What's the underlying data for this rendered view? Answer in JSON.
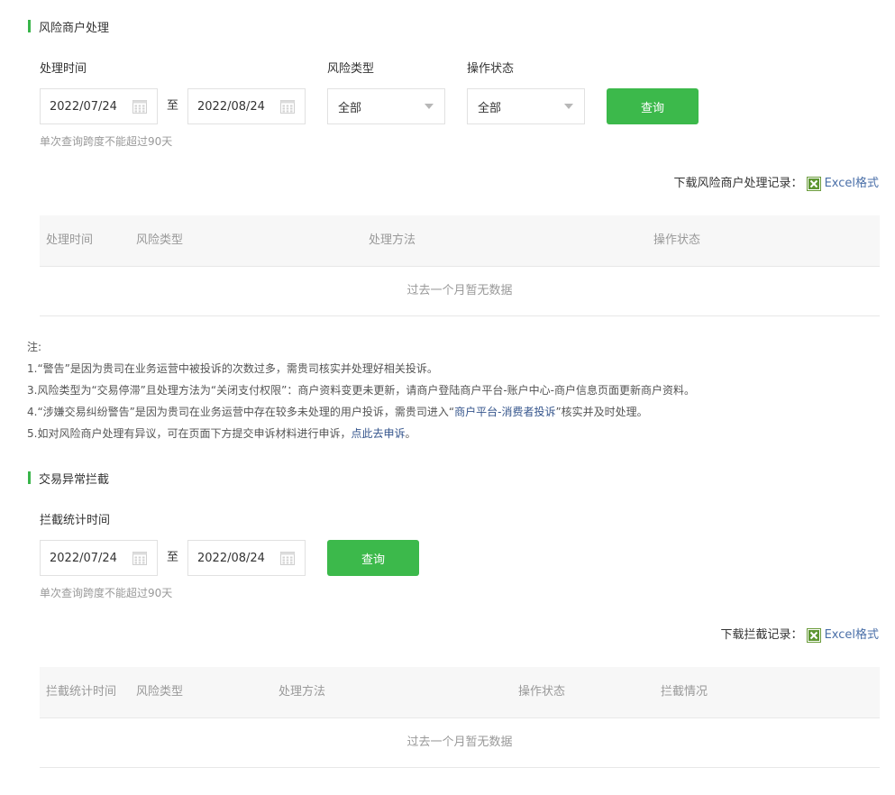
{
  "risk_section": {
    "title": "风险商户处理",
    "labels": {
      "time": "处理时间",
      "risk_type": "风险类型",
      "status": "操作状态"
    },
    "start_date": "2022/07/24",
    "to": "至",
    "end_date": "2022/08/24",
    "risk_type_value": "全部",
    "status_value": "全部",
    "query_button": "查询",
    "hint": "单次查询跨度不能超过90天",
    "download_label": "下载风险商户处理记录：",
    "download_link": "Excel格式",
    "table": {
      "headers": [
        "处理时间",
        "风险类型",
        "处理方法",
        "操作状态"
      ],
      "empty": "过去一个月暂无数据"
    }
  },
  "notes": {
    "heading": "注:",
    "line1": "1.“警告”是因为贵司在业务运营中被投诉的次数过多，需贵司核实并处理好相关投诉。",
    "line3": "3.风险类型为“交易停滞”且处理方法为“关闭支付权限”：商户资料变更未更新，请商户登陆商户平台-账户中心-商户信息页面更新商户资料。",
    "line4_pre": "4.“涉嫌交易纠纷警告”是因为贵司在业务运营中存在较多未处理的用户投诉，需贵司进入“",
    "line4_link": "商户平台-消费者投诉",
    "line4_post": "”核实并及时处理。",
    "line5_pre": "5.如对风险商户处理有异议，可在页面下方提交申诉材料进行申诉，",
    "line5_link": "点此去申诉",
    "line5_post": "。"
  },
  "intercept_section": {
    "title": "交易异常拦截",
    "label_time": "拦截统计时间",
    "start_date": "2022/07/24",
    "to": "至",
    "end_date": "2022/08/24",
    "query_button": "查询",
    "hint": "单次查询跨度不能超过90天",
    "download_label": "下载拦截记录：",
    "download_link": "Excel格式",
    "table": {
      "headers": [
        "拦截统计时间",
        "风险类型",
        "处理方法",
        "操作状态",
        "拦截情况"
      ],
      "empty": "过去一个月暂无数据"
    }
  },
  "icons": {
    "date_picker": "calendar-icon",
    "dropdown": "chevron-down-icon",
    "excel": "excel-icon"
  },
  "colors": {
    "accent_green": "#3cb94b",
    "link_blue": "#4a6fa8"
  }
}
